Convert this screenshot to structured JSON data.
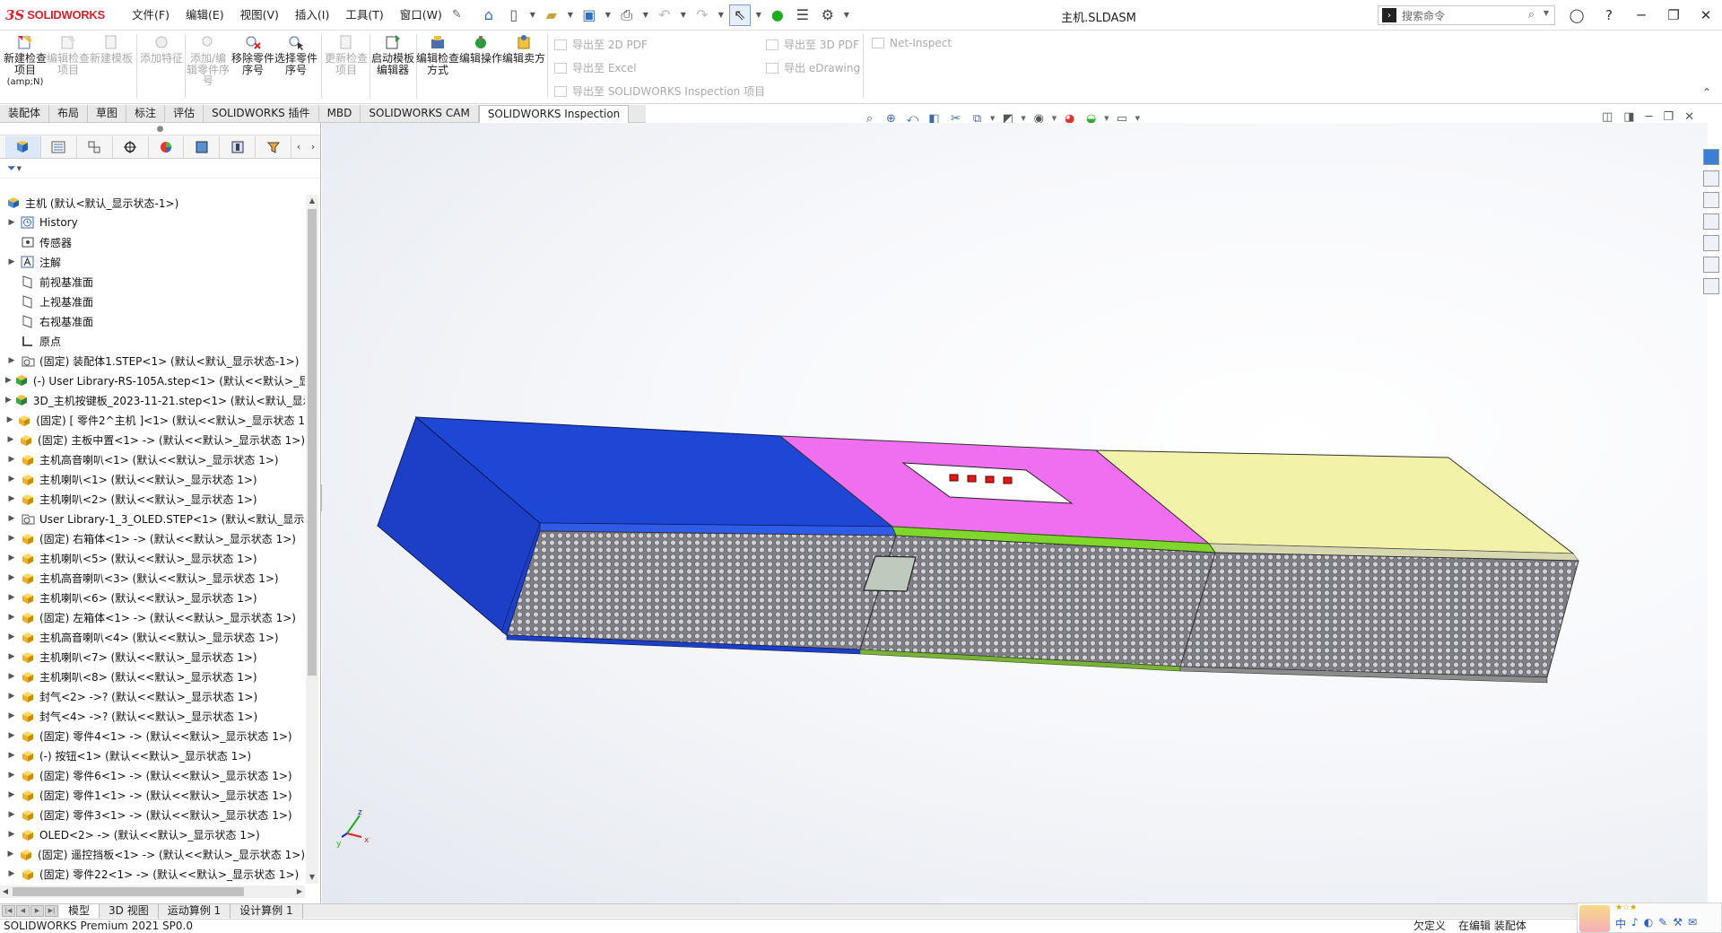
{
  "app": {
    "brand_ds": "3S",
    "brand_name": "SOLIDWORKS",
    "doc_title": "主机.SLDASM"
  },
  "menu": [
    "文件(F)",
    "编辑(E)",
    "视图(V)",
    "插入(I)",
    "工具(T)",
    "窗口(W)"
  ],
  "search": {
    "placeholder": "搜索命令"
  },
  "ribbon": {
    "buttons": [
      {
        "label": "新建检查项目",
        "sub": "(amp;N)",
        "enabled": true
      },
      {
        "label": "编辑检查项目",
        "enabled": false
      },
      {
        "label": "新建模板",
        "enabled": false
      },
      {
        "label": "添加特征",
        "enabled": false
      },
      {
        "label": "添加/编辑零件序号",
        "enabled": false
      },
      {
        "label": "移除零件序号",
        "enabled": true
      },
      {
        "label": "选择零件序号",
        "enabled": true
      },
      {
        "label": "更新检查项目",
        "enabled": false
      },
      {
        "label": "启动模板编辑器",
        "enabled": true
      },
      {
        "label": "编辑检查方式",
        "enabled": true
      },
      {
        "label": "编辑操作",
        "enabled": true
      },
      {
        "label": "编辑卖方",
        "enabled": true
      }
    ],
    "exports": [
      "导出至 2D PDF",
      "导出至 Excel",
      "导出至 SOLIDWORKS Inspection 项目",
      "导出至 3D PDF",
      "导出 eDrawing",
      "Net-Inspect"
    ]
  },
  "tabs": [
    {
      "label": "装配体",
      "active": false
    },
    {
      "label": "布局",
      "active": false
    },
    {
      "label": "草图",
      "active": false
    },
    {
      "label": "标注",
      "active": false
    },
    {
      "label": "评估",
      "active": false
    },
    {
      "label": "SOLIDWORKS 插件",
      "active": false
    },
    {
      "label": "MBD",
      "active": false
    },
    {
      "label": "SOLIDWORKS CAM",
      "active": false
    },
    {
      "label": "SOLIDWORKS Inspection",
      "active": true
    }
  ],
  "tree": [
    {
      "label": "主机  (默认<默认_显示状态-1>)",
      "type": "assembly",
      "root": true
    },
    {
      "label": "History",
      "type": "history",
      "expand": true
    },
    {
      "label": "传感器",
      "type": "sensor",
      "expand": false
    },
    {
      "label": "注解",
      "type": "annotation",
      "expand": true
    },
    {
      "label": "前视基准面",
      "type": "plane",
      "expand": false
    },
    {
      "label": "上视基准面",
      "type": "plane",
      "expand": false
    },
    {
      "label": "右视基准面",
      "type": "plane",
      "expand": false
    },
    {
      "label": "原点",
      "type": "origin",
      "expand": false
    },
    {
      "label": "(固定) 装配体1.STEP<1> (默认<默认_显示状态-1>)",
      "type": "subasm",
      "expand": true
    },
    {
      "label": "(-) User Library-RS-105A.step<1> (默认<<默认>_显",
      "type": "subasm-green",
      "expand": true
    },
    {
      "label": "3D_主机按键板_2023-11-21.step<1> (默认<默认_显示",
      "type": "subasm-green",
      "expand": true
    },
    {
      "label": "(固定) [ 零件2^主机 ]<1> (默认<<默认>_显示状态 1",
      "type": "part",
      "expand": true
    },
    {
      "label": "(固定) 主板中置<1> -> (默认<<默认>_显示状态 1>)",
      "type": "part",
      "expand": true
    },
    {
      "label": "主机高音喇叭<1> (默认<<默认>_显示状态 1>)",
      "type": "part",
      "expand": true
    },
    {
      "label": "主机喇叭<1> (默认<<默认>_显示状态 1>)",
      "type": "part",
      "expand": true
    },
    {
      "label": "主机喇叭<2> (默认<<默认>_显示状态 1>)",
      "type": "part",
      "expand": true
    },
    {
      "label": "User Library-1_3_OLED.STEP<1> (默认<默认_显示",
      "type": "subasm",
      "expand": true
    },
    {
      "label": "(固定) 右箱体<1> -> (默认<<默认>_显示状态 1>)",
      "type": "part",
      "expand": true
    },
    {
      "label": "主机喇叭<5> (默认<<默认>_显示状态 1>)",
      "type": "part",
      "expand": true
    },
    {
      "label": "主机高音喇叭<3> (默认<<默认>_显示状态 1>)",
      "type": "part",
      "expand": true
    },
    {
      "label": "主机喇叭<6> (默认<<默认>_显示状态 1>)",
      "type": "part",
      "expand": true
    },
    {
      "label": "(固定) 左箱体<1> -> (默认<<默认>_显示状态 1>)",
      "type": "part",
      "expand": true
    },
    {
      "label": "主机高音喇叭<4> (默认<<默认>_显示状态 1>)",
      "type": "part",
      "expand": true
    },
    {
      "label": "主机喇叭<7> (默认<<默认>_显示状态 1>)",
      "type": "part",
      "expand": true
    },
    {
      "label": "主机喇叭<8> (默认<<默认>_显示状态 1>)",
      "type": "part",
      "expand": true
    },
    {
      "label": "封气<2> ->? (默认<<默认>_显示状态 1>)",
      "type": "part",
      "expand": true
    },
    {
      "label": "封气<4> ->? (默认<<默认>_显示状态 1>)",
      "type": "part",
      "expand": true
    },
    {
      "label": "(固定) 零件4<1> -> (默认<<默认>_显示状态 1>)",
      "type": "part",
      "expand": true
    },
    {
      "label": "(-) 按钮<1> (默认<<默认>_显示状态 1>)",
      "type": "part",
      "expand": true
    },
    {
      "label": "(固定) 零件6<1> -> (默认<<默认>_显示状态 1>)",
      "type": "part",
      "expand": true
    },
    {
      "label": "(固定) 零件1<1> -> (默认<<默认>_显示状态 1>)",
      "type": "part",
      "expand": true
    },
    {
      "label": "(固定) 零件3<1> -> (默认<<默认>_显示状态 1>)",
      "type": "part",
      "expand": true
    },
    {
      "label": "OLED<2> -> (默认<<默认>_显示状态 1>)",
      "type": "part",
      "expand": true
    },
    {
      "label": "(固定) 遥控挡板<1> -> (默认<<默认>_显示状态 1>)",
      "type": "part",
      "expand": true
    },
    {
      "label": "(固定) 零件22<1> -> (默认<<默认>_显示状态 1>)",
      "type": "part",
      "expand": true
    }
  ],
  "triad": {
    "x": "x",
    "y": "y",
    "z": "z"
  },
  "bottom_tabs": [
    {
      "label": "模型",
      "active": true
    },
    {
      "label": "3D 视图",
      "active": false
    },
    {
      "label": "运动算例 1",
      "active": false
    },
    {
      "label": "设计算例 1",
      "active": false
    }
  ],
  "status": {
    "version": "SOLIDWORKS Premium 2021 SP0.0",
    "custom": "欠定义",
    "editing": "在编辑 装配体"
  },
  "ime": {
    "chars": [
      "中",
      "♪",
      "◐",
      "✎",
      "⚒",
      "✉"
    ]
  },
  "colors": {
    "box_blue": "#1f47d6",
    "top_magenta": "#f06ff0",
    "top_yellow": "#f2f2a8",
    "trim_green": "#7ed72a",
    "mesh_gray": "#8f8f96",
    "brand_red": "#d8232a"
  }
}
